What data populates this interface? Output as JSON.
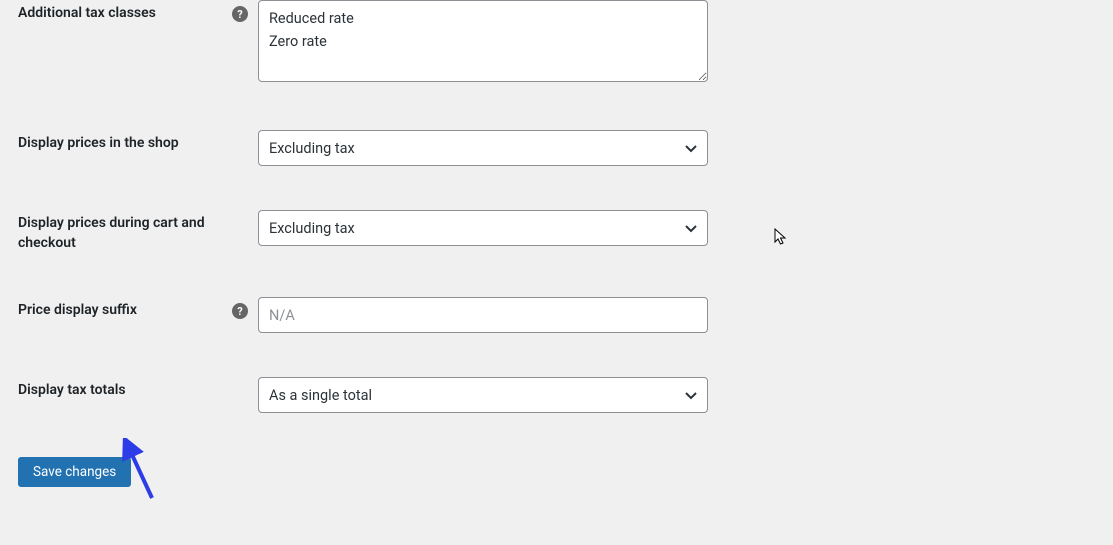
{
  "fields": {
    "additional_tax_classes": {
      "label": "Additional tax classes",
      "value": "Reduced rate\nZero rate",
      "has_help": true
    },
    "display_prices_shop": {
      "label": "Display prices in the shop",
      "value": "Excluding tax",
      "has_help": false
    },
    "display_prices_cart": {
      "label": "Display prices during cart and checkout",
      "value": "Excluding tax",
      "has_help": false
    },
    "price_display_suffix": {
      "label": "Price display suffix",
      "placeholder": "N/A",
      "value": "",
      "has_help": true
    },
    "display_tax_totals": {
      "label": "Display tax totals",
      "value": "As a single total",
      "has_help": false
    }
  },
  "buttons": {
    "save": "Save changes"
  }
}
